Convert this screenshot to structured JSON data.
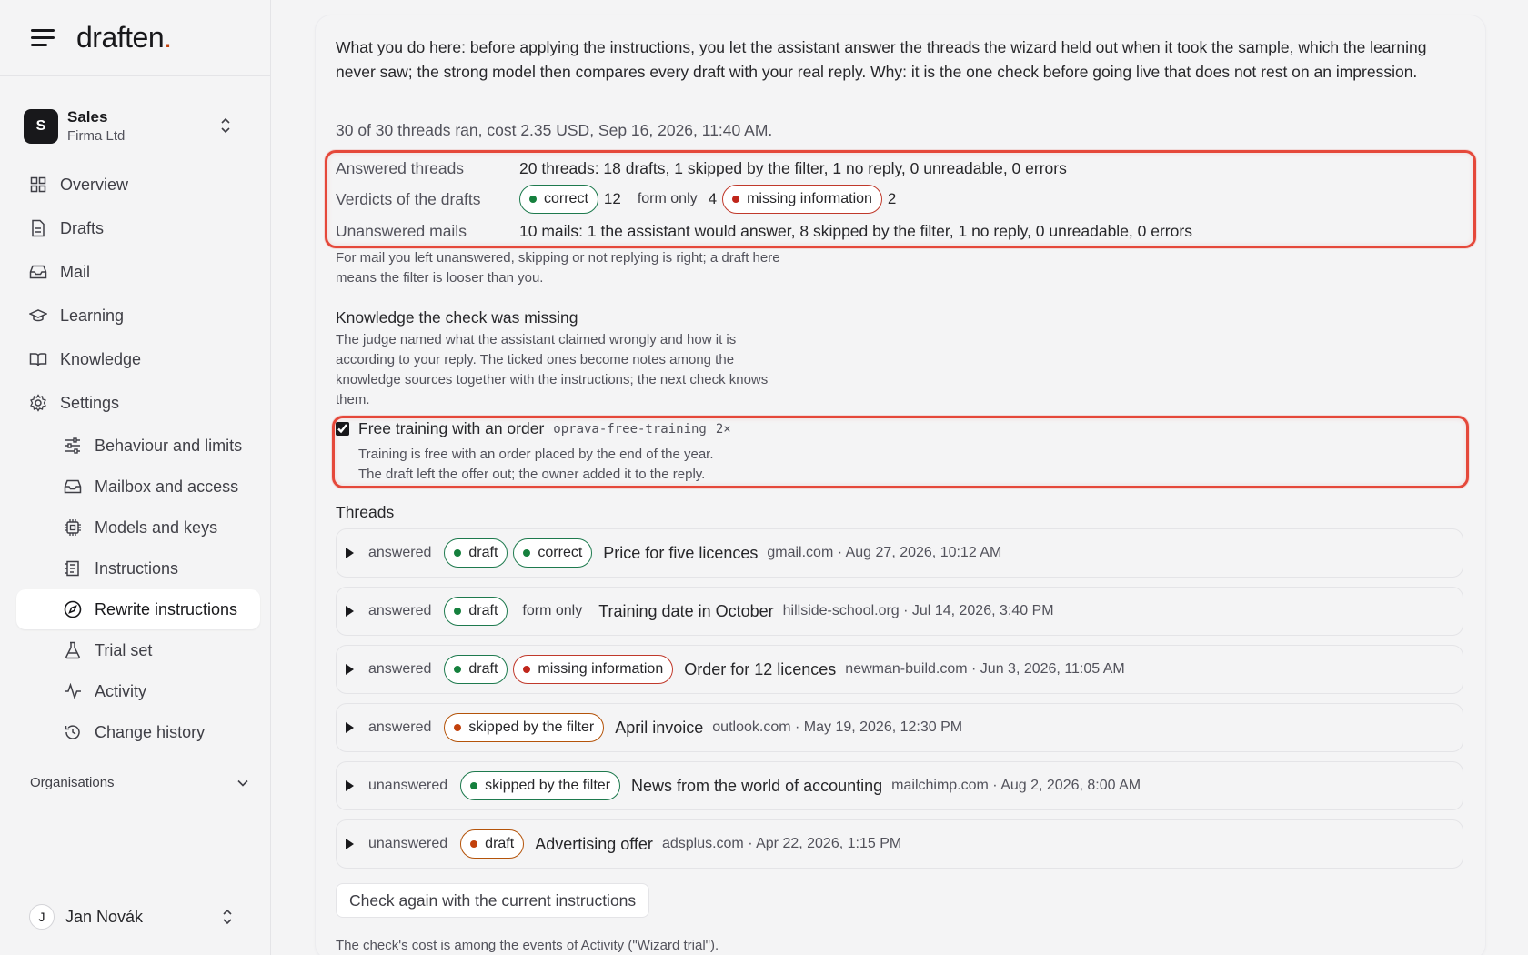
{
  "brand": {
    "name": "draften",
    "dot": "."
  },
  "org": {
    "initial": "S",
    "name": "Sales",
    "company": "Firma Ltd"
  },
  "nav": {
    "overview": "Overview",
    "drafts": "Drafts",
    "mail": "Mail",
    "learning": "Learning",
    "knowledge": "Knowledge",
    "settings": "Settings",
    "behaviour": "Behaviour and limits",
    "mailbox": "Mailbox and access",
    "models": "Models and keys",
    "instructions": "Instructions",
    "rewrite": "Rewrite instructions",
    "trial": "Trial set",
    "activity": "Activity",
    "history": "Change history"
  },
  "organisations_label": "Organisations",
  "user": {
    "initial": "J",
    "name": "Jan Novák"
  },
  "main": {
    "intro": "What you do here: before applying the instructions, you let the assistant answer the threads the wizard held out when it took the sample, which the learning never saw; the strong model then compares every draft with your real reply. Why: it is the one check before going live that does not rest on an impression.",
    "ran": "30 of 30 threads ran, cost 2.35 USD, Sep 16, 2026, 11:40 AM.",
    "summary": {
      "answered_label": "Answered threads",
      "answered_value": "20 threads: 18 drafts, 1 skipped by the filter, 1 no reply, 0 unreadable, 0 errors",
      "verdicts_label": "Verdicts of the drafts",
      "verdict_correct": "correct",
      "verdict_correct_count": "12",
      "verdict_form": "form only",
      "verdict_form_count": "4",
      "verdict_missing": "missing information",
      "verdict_missing_count": "2",
      "unanswered_label": "Unanswered mails",
      "unanswered_value": "10 mails: 1 the assistant would answer, 8 skipped by the filter, 1 no reply, 0 unreadable, 0 errors"
    },
    "note": "For mail you left unanswered, skipping or not replying is right; a draft here means the filter is looser than you.",
    "knowledge_title": "Knowledge the check was missing",
    "knowledge_desc": "The judge named what the assistant claimed wrongly and how it is according to your reply. The ticked ones become notes among the knowledge sources together with the instructions; the next check knows them.",
    "finding": {
      "title": "Free training with an order",
      "slug": "oprava-free-training",
      "count": "2×",
      "line1": "Training is free with an order placed by the end of the year.",
      "line2": "The draft left the offer out; the owner added it to the reply."
    },
    "threads_title": "Threads",
    "threads": [
      {
        "state": "answered",
        "pill1": "draft",
        "pill2": "correct",
        "subject": "Price for five licences",
        "meta": "gmail.com · Aug 27, 2026, 10:12 AM"
      },
      {
        "state": "answered",
        "pill1": "draft",
        "pill2": "form only",
        "subject": "Training date in October",
        "meta": "hillside-school.org · Jul 14, 2026, 3:40 PM"
      },
      {
        "state": "answered",
        "pill1": "draft",
        "pill2": "missing information",
        "subject": "Order for 12 licences",
        "meta": "newman-build.com · Jun 3, 2026, 11:05 AM"
      },
      {
        "state": "answered",
        "pill1": "skipped by the filter",
        "subject": "April invoice",
        "meta": "outlook.com · May 19, 2026, 12:30 PM"
      },
      {
        "state": "unanswered",
        "pill1": "skipped by the filter",
        "subject": "News from the world of accounting",
        "meta": "mailchimp.com · Aug 2, 2026, 8:00 AM"
      },
      {
        "state": "unanswered",
        "pill1": "draft",
        "subject": "Advertising offer",
        "meta": "adsplus.com · Apr 22, 2026, 1:15 PM"
      }
    ],
    "check_again": "Check again with the current instructions",
    "footer": "The check's cost is among the events of Activity (\"Wizard trial\")."
  },
  "colors": {
    "accent_red": "#e5483a",
    "green": "#15803d",
    "red": "#c0261b",
    "orange": "#c2410c"
  }
}
